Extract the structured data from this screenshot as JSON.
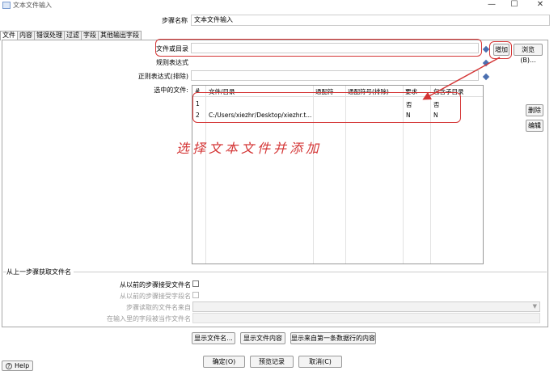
{
  "window": {
    "title": "文本文件输入",
    "minimize": "—",
    "maximize": "☐",
    "close": "✕"
  },
  "step": {
    "label": "步骤名称",
    "value": "文本文件输入"
  },
  "tabs": [
    "文件",
    "内容",
    "错误处理",
    "过滤",
    "字段",
    "其他输出字段"
  ],
  "file": {
    "file_or_dir_label": "文件或目录",
    "file_or_dir_value": "",
    "regex_label": "规则表达式",
    "regex_exclude_label": "正则表达式(排除)",
    "selected_files_label": "选中的文件:",
    "add_button": "增加",
    "browse_button": "浏览(B)...",
    "delete_button": "删除",
    "edit_button": "编辑"
  },
  "table": {
    "corner": "#",
    "columns": [
      "文件/目录",
      "通配符",
      "通配符号(排除)",
      "要求",
      "包含子目录"
    ],
    "rows": [
      {
        "num": "1",
        "path": "",
        "wildcard": "",
        "exclude": "",
        "required": "否",
        "subdirs": "否"
      },
      {
        "num": "2",
        "path": "C:/Users/xiezhr/Desktop/xiezhr.t...",
        "wildcard": "",
        "exclude": "",
        "required": "N",
        "subdirs": "N"
      }
    ]
  },
  "annotation": {
    "text": "选择文本文件并添加",
    "color": "#d43535"
  },
  "previous_step": {
    "title": "从上一步骤获取文件名",
    "accept_filenames_label": "从以前的步骤接受文件名",
    "pass_through_label": "从以前的步骤接受字段名",
    "step_to_read_label": "步骤读取的文件名来自",
    "field_in_input_label": "在输入里的字段被当作文件名"
  },
  "bottom_buttons": {
    "show_filenames": "显示文件名...",
    "show_content": "显示文件内容",
    "show_first_rows": "显示来自第一条数据行的内容"
  },
  "footer": {
    "ok": "确定(O)",
    "preview": "预览记录",
    "cancel": "取消(C)",
    "help": "Help"
  }
}
